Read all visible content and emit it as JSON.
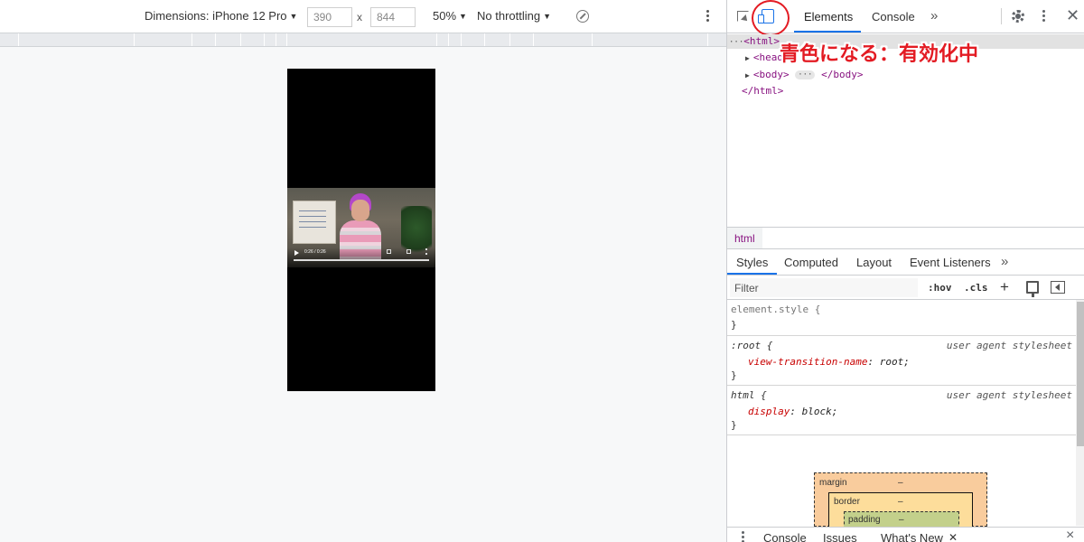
{
  "device_toolbar": {
    "dimensions_label": "Dimensions: iPhone 12 Pro",
    "width_value": "390",
    "times_symbol": "x",
    "height_value": "844",
    "zoom_label": "50%",
    "throttling_label": "No throttling",
    "caret": "▼"
  },
  "video": {
    "time_label": "0:26 / 0:26"
  },
  "devtools": {
    "tabs": [
      "Elements",
      "Console"
    ],
    "more": "»",
    "close": "✕",
    "annotation": "青色になる：有効化中",
    "dom": {
      "html_open": "<html>",
      "head": "<head>",
      "body_open": "<body>",
      "ellipsis": "···",
      "body_close": "</body>",
      "html_close": "</html>",
      "dots": "···"
    },
    "breadcrumb": "html",
    "sub_tabs": [
      "Styles",
      "Computed",
      "Layout",
      "Event Listeners"
    ],
    "filter_placeholder": "Filter",
    "hov": ":hov",
    "cls": ".cls",
    "plus": "+",
    "rules": [
      {
        "selector": "element.style {",
        "close": "}"
      },
      {
        "selector": ":root {",
        "source": "user agent stylesheet",
        "prop": "view-transition-name",
        "value": "root;",
        "close": "}"
      },
      {
        "selector": "html {",
        "source": "user agent stylesheet",
        "prop": "display",
        "value": "block;",
        "close": "}"
      }
    ],
    "box_model": {
      "margin_label": "margin",
      "margin_value": "–",
      "border_label": "border",
      "border_value": "–",
      "padding_label": "padding",
      "padding_value": "–"
    },
    "drawer_tabs": [
      "Console",
      "Issues",
      "What's New"
    ],
    "drawer_close": "×"
  }
}
